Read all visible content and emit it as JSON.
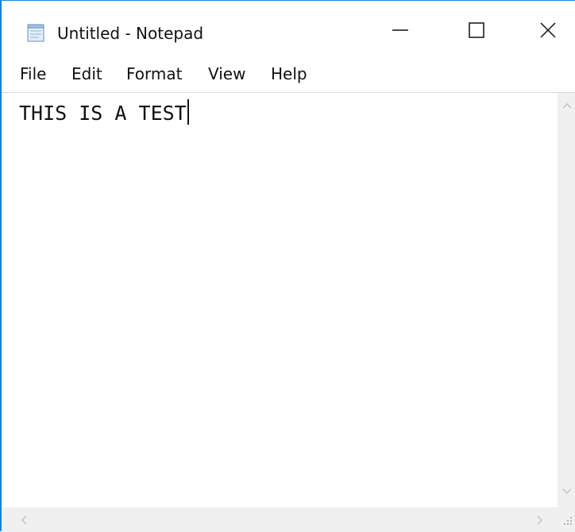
{
  "window": {
    "title": "Untitled - Notepad",
    "accent_color": "#1883d7",
    "app_icon": "notepad-icon",
    "controls": [
      "minimize-icon",
      "maximize-icon",
      "close-icon"
    ]
  },
  "menu": {
    "items": [
      {
        "label": "File"
      },
      {
        "label": "Edit"
      },
      {
        "label": "Format"
      },
      {
        "label": "View"
      },
      {
        "label": "Help"
      }
    ]
  },
  "editor": {
    "text": "THIS IS A TEST"
  },
  "scrollbars": {
    "vertical_icons": [
      "chevron-up-icon",
      "chevron-down-icon"
    ],
    "horizontal_icons": [
      "chevron-left-icon",
      "chevron-right-icon"
    ],
    "grip_icon": "resize-grip-icon"
  }
}
